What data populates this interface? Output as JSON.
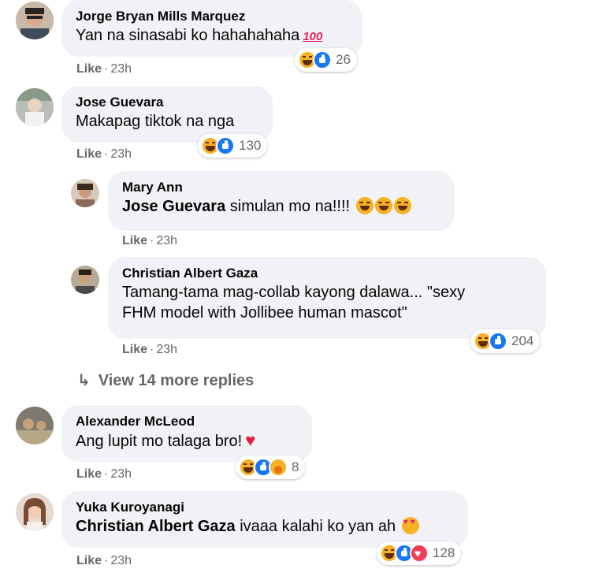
{
  "comments": [
    {
      "author": "Jorge Bryan Mills Marquez",
      "text": "Yan na sinasabi ko hahahahaha",
      "emoji": "100",
      "like": "Like",
      "time": "23h",
      "reaction_count": "26"
    },
    {
      "author": "Jose Guevara",
      "text": "Makapag tiktok na nga",
      "like": "Like",
      "time": "23h",
      "reaction_count": "130",
      "replies": [
        {
          "author": "Mary Ann",
          "mention": "Jose Guevara",
          "text": "simulan mo na!!!!",
          "like": "Like",
          "time": "23h"
        },
        {
          "author": "Christian Albert Gaza",
          "text_line1": "Tamang-tama mag-collab kayong dalawa... \"sexy",
          "text_line2": "FHM model with Jollibee human mascot\"",
          "like": "Like",
          "time": "23h",
          "reaction_count": "204"
        }
      ],
      "view_more": "View 14 more replies"
    },
    {
      "author": "Alexander McLeod",
      "text": "Ang lupit mo talaga bro!",
      "like": "Like",
      "time": "23h",
      "reaction_count": "8"
    },
    {
      "author": "Yuka Kuroyanagi",
      "mention": "Christian Albert Gaza",
      "text": "ivaaa kalahi ko yan ah",
      "like": "Like",
      "time": "23h",
      "reaction_count": "128"
    }
  ],
  "colors": {
    "bubble": "#f0f2f5",
    "meta_text": "#65676b",
    "like_blue": "#1877f2",
    "haha_yellow": "#f7b125",
    "love_red": "#f33e58"
  }
}
